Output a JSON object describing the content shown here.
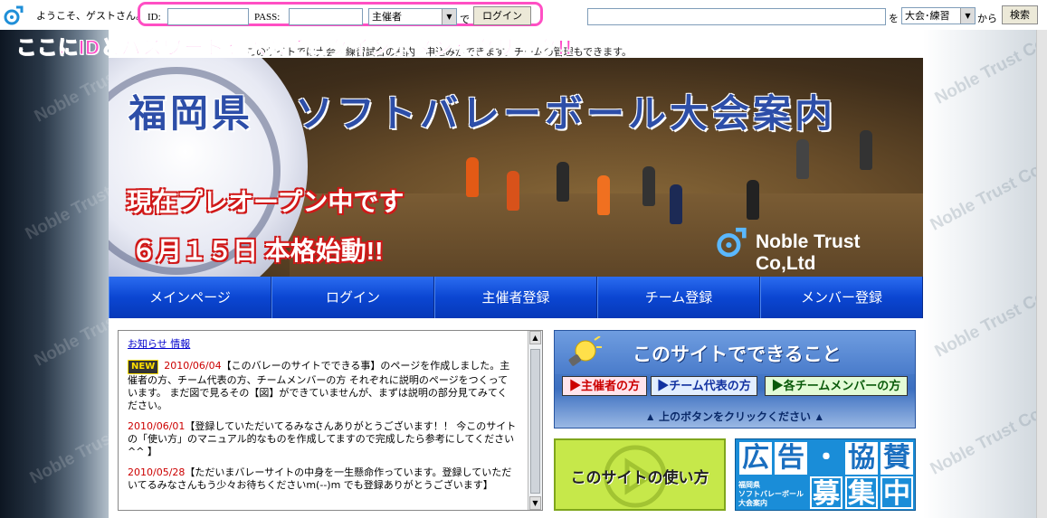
{
  "header": {
    "welcome": "ようこそ、ゲストさん。",
    "id_label": "ID:",
    "id_value": "",
    "pass_label": "PASS:",
    "pass_value": "",
    "role_select": "主催者",
    "de": "で",
    "login_button": "ログイン",
    "search_value": "",
    "wo": "を",
    "search_type": "大会･練習",
    "kara": "から",
    "search_button": "検索"
  },
  "instruction": "ここにIDとパスワードを入れてログインボタンをクリック!!",
  "intro_text": "このサイトでは大会・練習試合の案内、申込みができます。チームの管理もできます。",
  "banner": {
    "title": "福岡県　ソフトバレーボール大会案内",
    "subtitle1": "現在プレオープン中です",
    "subtitle2": "６月１５日 本格始動!!",
    "logo_text": "Noble Trust Co,Ltd"
  },
  "watermark": "Noble Trust Co,Ltd",
  "nav": [
    "メインページ",
    "ログイン",
    "主催者登録",
    "チーム登録",
    "メンバー登録"
  ],
  "news": {
    "heading": "お知らせ 情報",
    "new_badge": "NEW",
    "entries": [
      {
        "date": "2010/06/04",
        "text": "【このバレーのサイトでできる事】のページを作成しました。主催者の方、チーム代表の方、チームメンバーの方 それぞれに説明のページをつくっています。 まだ図で見るその【図】ができていませんが、まずは説明の部分見てみてください。"
      },
      {
        "date": "2010/06/01",
        "text": "【登録していただいてるみなさんありがとうございます！！ 今このサイトの「使い方」のマニュアル的なものを作成してますので完成したら参考にしてください^^ 】"
      },
      {
        "date": "2010/05/28",
        "text": "【ただいまバレーサイトの中身を一生懸命作っています。登録していただいてるみなさんもう少々お待ちくださいm(--)m でも登録ありがとうございます】"
      }
    ]
  },
  "can_do": {
    "title": "このサイトでできること",
    "buttons": [
      "主催者の方",
      "チーム代表の方",
      "各チームメンバーの方"
    ],
    "hint": "▲ 上のボタンをクリックください ▲"
  },
  "how_to": "このサイトの使い方",
  "ad": {
    "chars": [
      "広",
      "告",
      "・",
      "協",
      "賛",
      "募",
      "集",
      "中"
    ],
    "small_text": [
      "福岡県",
      "ソフトバレーボール",
      "大会案内"
    ]
  },
  "colors": {
    "accent_pink": "#ff49c7",
    "nav_blue": "#0b46d2",
    "date_red": "#cc0000"
  }
}
